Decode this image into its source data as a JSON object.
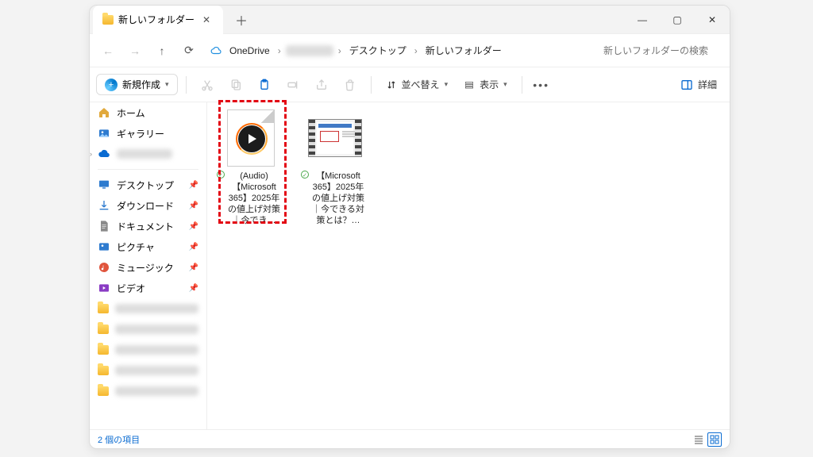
{
  "tab": {
    "title": "新しいフォルダー"
  },
  "breadcrumbs": {
    "root": "OneDrive",
    "mid": "■■■■■",
    "desktop": "デスクトップ",
    "current": "新しいフォルダー"
  },
  "search": {
    "placeholder": "新しいフォルダーの検索"
  },
  "toolbar": {
    "new": "新規作成",
    "sort": "並べ替え",
    "view": "表示",
    "details": "詳細"
  },
  "sidebar": {
    "home": "ホーム",
    "gallery": "ギャラリー",
    "onedrive": "■■■■■",
    "desktop": "デスクトップ",
    "downloads": "ダウンロード",
    "documents": "ドキュメント",
    "pictures": "ピクチャ",
    "music": "ミュージック",
    "videos": "ビデオ"
  },
  "files": [
    {
      "name": "(Audio)【Microsoft 365】2025年の値上げ対策｜今でき…"
    },
    {
      "name": "【Microsoft 365】2025年の値上げ対策｜今できる対策とは？…"
    }
  ],
  "status": {
    "count": "2 個の項目"
  }
}
